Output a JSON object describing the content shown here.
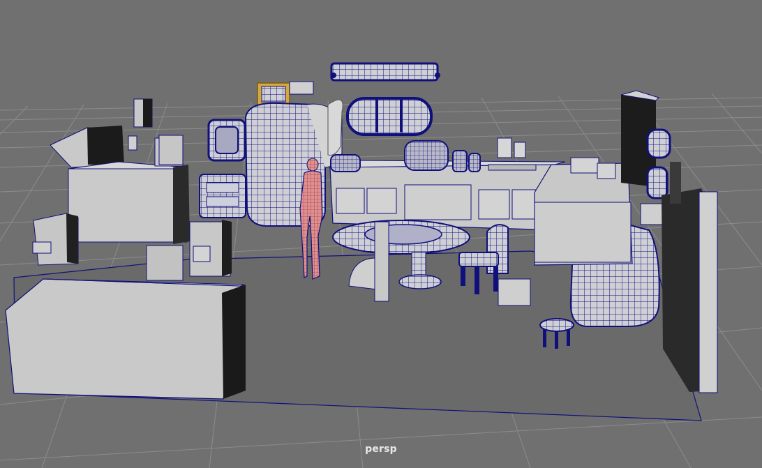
{
  "viewport": {
    "camera_name": "persp",
    "background_color": "#707070",
    "grid_color": "#8a8a8a",
    "wire_color": "#10107a",
    "shaded_color": "#c8c8c8",
    "selected_color": "#e0b040",
    "character_color": "#d87878"
  }
}
